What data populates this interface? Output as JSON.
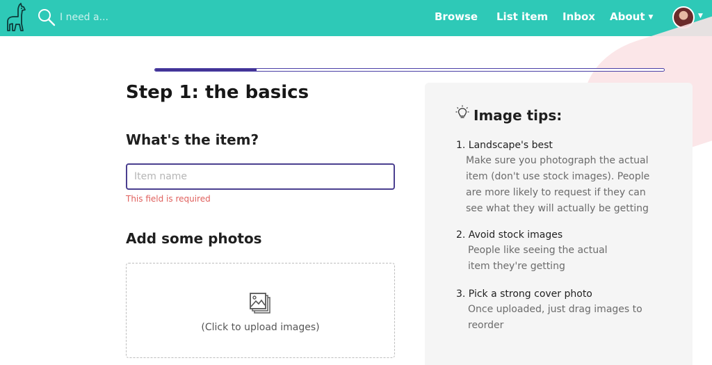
{
  "nav": {
    "search_placeholder": "I need a...",
    "browse": "Browse",
    "list_item": "List item",
    "inbox": "Inbox",
    "about": "About"
  },
  "progress": {
    "fraction": 0.2
  },
  "form": {
    "step_title": "Step 1: the basics",
    "item_heading": "What's the item?",
    "item_placeholder": "Item name",
    "item_value": "",
    "item_error": "This field is required",
    "photos_heading": "Add some photos",
    "upload_text": "(Click to upload images)"
  },
  "tips": {
    "title": "Image tips:",
    "items": [
      {
        "title": "1. Landscape's best",
        "body": "Make sure you photograph the actual item (don't use stock images). People are more likely to request if they can see what they will actually be getting"
      },
      {
        "title": "2. Avoid stock images",
        "body": "People like seeing the actual item they're getting"
      },
      {
        "title": "3. Pick a strong cover photo",
        "body": "Once uploaded, just drag images to reorder"
      }
    ]
  },
  "colors": {
    "navbar": "#2ec9b7",
    "progress": "#433394",
    "error": "#e0605d",
    "panel": "#f5f5f5"
  },
  "icons": {
    "logo": "llama-logo-icon",
    "search": "search-icon",
    "avatar": "user-avatar",
    "upload": "image-gallery-icon",
    "tips": "lightbulb-icon"
  }
}
